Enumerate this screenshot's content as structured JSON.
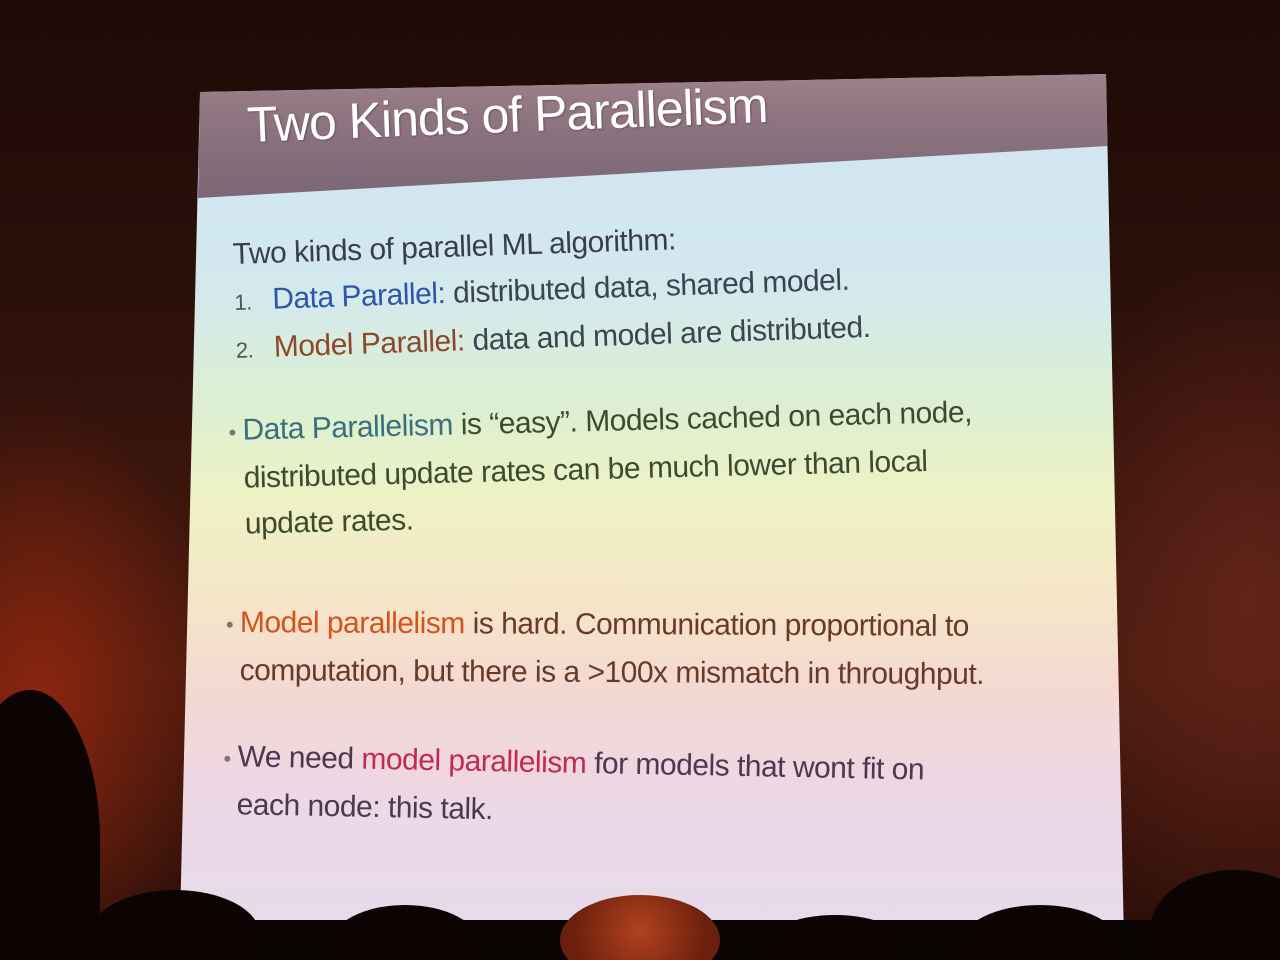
{
  "slide": {
    "title": "Two Kinds of Parallelism",
    "intro": "Two kinds of parallel ML algorithm:",
    "list": [
      {
        "number": "1.",
        "keyword": "Data Parallel:",
        "text": " distributed data, shared model."
      },
      {
        "number": "2.",
        "keyword": "Model Parallel:",
        "text": " data and model are distributed."
      }
    ],
    "bullet_data": {
      "dot": "•",
      "keyword": "Data Parallelism",
      "line1_rest": " is “easy”. Models cached on each node,",
      "line2": "distributed update rates can be much lower than local",
      "line3": "update rates."
    },
    "bullet_model": {
      "dot": "•",
      "keyword": "Model parallelism",
      "line1_rest": " is hard. Communication proportional to",
      "line2": "computation, but there is a >100x mismatch in throughput."
    },
    "bullet_need": {
      "dot": "•",
      "prefix": "We need ",
      "keyword": "model parallelism",
      "line1_rest": " for models that wont fit on",
      "line2": "each node: this talk."
    }
  },
  "colors": {
    "title_bar": "#8e7480",
    "keyword_data": "#2f55a8",
    "keyword_model": "#8a4a2a",
    "keyword_data_parallelism": "#3a6f80",
    "keyword_model_parallelism": "#d4531a",
    "keyword_need_model_parallelism": "#c12a52"
  }
}
